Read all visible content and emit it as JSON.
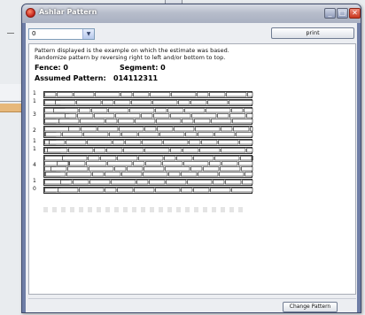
{
  "window": {
    "title": "Ashlar Pattern",
    "minimize_glyph": "_",
    "maximize_glyph": "□",
    "close_glyph": "✕"
  },
  "toolbar": {
    "combo_value": "0",
    "combo_arrow": "▼",
    "print_label": "print"
  },
  "content": {
    "description_line1": "Pattern displayed is the example on which the estimate was based.",
    "description_line2": "Randomize pattern by reversing right to left and/or bottom to top.",
    "fence_label": "Fence: 0",
    "segment_label": "Segment: 0",
    "assumed_pattern_label": "Assumed Pattern:",
    "assumed_pattern_value": "014112311",
    "row_numbers": [
      "1",
      "1",
      "3",
      "2",
      "1",
      "1",
      "4",
      "1",
      "0"
    ]
  },
  "footer": {
    "change_pattern_label": "Change Pattern"
  },
  "colors": {
    "window_frame": "#6e7da6",
    "brick_fill": "#ffffff",
    "brick_mortar": "#333333"
  }
}
